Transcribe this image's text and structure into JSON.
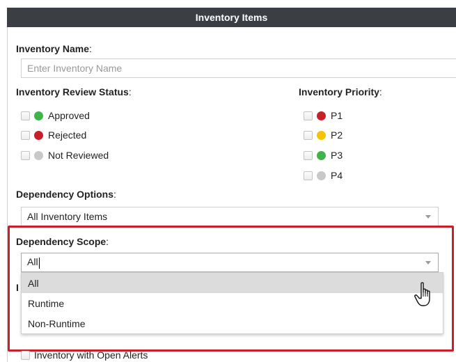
{
  "panel": {
    "title": "Inventory Items"
  },
  "inventory_name": {
    "label": "Inventory Name",
    "colon": ":",
    "placeholder": "Enter Inventory Name",
    "value": ""
  },
  "review_status": {
    "label": "Inventory Review Status",
    "colon": ":",
    "options": [
      {
        "label": "Approved",
        "color": "#3db54a",
        "checked": false
      },
      {
        "label": "Rejected",
        "color": "#c8202a",
        "checked": false
      },
      {
        "label": "Not Reviewed",
        "color": "#c8c8c8",
        "checked": false
      }
    ]
  },
  "priority": {
    "label": "Inventory Priority",
    "colon": ":",
    "options": [
      {
        "label": "P1",
        "color": "#c8202a",
        "checked": false
      },
      {
        "label": "P2",
        "color": "#f5c400",
        "checked": false
      },
      {
        "label": "P3",
        "color": "#3db54a",
        "checked": false
      },
      {
        "label": "P4",
        "color": "#c8c8c8",
        "checked": false
      }
    ]
  },
  "dependency_options": {
    "label": "Dependency Options",
    "colon": ":",
    "selected": "All Inventory Items"
  },
  "dependency_scope": {
    "label": "Dependency Scope",
    "colon": ":",
    "selected": "All",
    "options": [
      "All",
      "Runtime",
      "Non-Runtime"
    ],
    "highlighted_option": "All"
  },
  "hidden_label_start": "I",
  "notifications": {
    "label_partial": "Inventory Notifications",
    "first_option": "Inventory with Open Alerts"
  },
  "colors": {
    "header_bg": "#3b3f44",
    "highlight_border": "#c8202a",
    "selected_option_bg": "#dcdcdc"
  },
  "icons": {
    "cursor": "hand-pointer-icon",
    "dropdown": "caret-down-icon"
  }
}
